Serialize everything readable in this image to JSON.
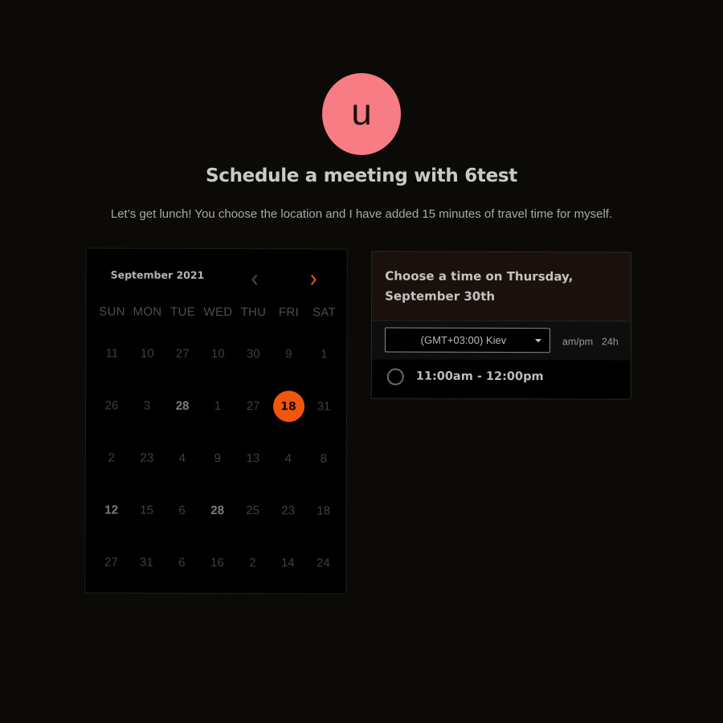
{
  "host": {
    "avatar_initial": "u",
    "avatar_color": "#f77c84"
  },
  "heading": {
    "title": "Schedule a meeting with 6test",
    "description": "Let’s get lunch! You choose the location and I have added 15 minutes of travel time for myself."
  },
  "calendar": {
    "month_label": "September 2021",
    "prev_icon": "chevron-left-icon",
    "next_icon": "chevron-right-icon",
    "accent_color": "#f0560d",
    "weekdays": [
      "SUN",
      "MON",
      "TUE",
      "WED",
      "THU",
      "FRI",
      "SAT"
    ],
    "weeks": [
      [
        "11",
        "10",
        "27",
        "10",
        "30",
        "9",
        "1"
      ],
      [
        "26",
        "3",
        "28",
        "1",
        "27",
        "18",
        "31"
      ],
      [
        "2",
        "23",
        "4",
        "9",
        "13",
        "4",
        "8"
      ],
      [
        "12",
        "15",
        "6",
        "28",
        "25",
        "23",
        "18"
      ],
      [
        "27",
        "31",
        "6",
        "16",
        "2",
        "14",
        "24"
      ]
    ],
    "bold_cells": [
      [
        1,
        2
      ],
      [
        3,
        0
      ],
      [
        3,
        3
      ]
    ],
    "selected_cell": [
      1,
      5
    ]
  },
  "time_picker": {
    "header_line1": "Choose a time on Thursday,",
    "header_line2": "September 30th",
    "timezone": "(GMT+03:00) Kiev",
    "format_ampm": "am/pm",
    "format_24h": "24h",
    "slots": [
      "11:00am - 12:00pm"
    ]
  }
}
